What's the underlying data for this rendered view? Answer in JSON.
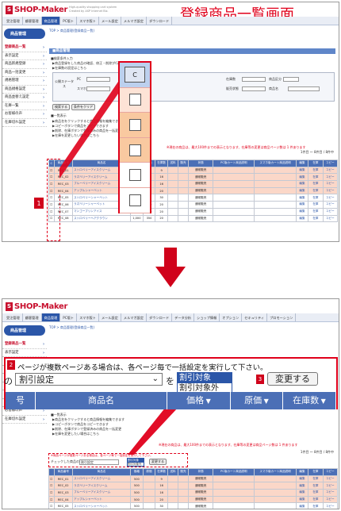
{
  "top": {
    "title_overlay": "登録商品一覧画面",
    "logo": "SHOP-Maker",
    "tagline": "High-quality shopping cart system\nCreated by ASP Internet Biz.",
    "nav": [
      "受注管理",
      "顧客管理",
      "商品管理",
      "PC版ト",
      "スマホ版ト",
      "メール設定",
      "メルマガ設定",
      "ダウンロード"
    ],
    "nav_active": 2,
    "sidebar_cat": "商品管理",
    "sidebar": [
      "登録商品一覧",
      "表示設定",
      "商品新規登録",
      "商品一括変更",
      "規格管理",
      "商品規格設定",
      "商品並替え設定",
      "在庫一覧",
      "お客様の声",
      "在庫切れ設定"
    ],
    "crumb": "TOP > 商品管理(登録商品一覧)",
    "section": "■商品管理",
    "search_heading": "■検索条件入力",
    "search_notes": [
      "▶商品登録をした商品の確認、修正・削除が行えます",
      "▶在庫数の設定はこちら"
    ],
    "labels": {
      "status": "公開ステータス",
      "pc": "PC",
      "smart": "スマホ",
      "stock": "在庫数",
      "category": "商品区分",
      "cart": "カート",
      "kind": "販売状態",
      "brand": "商品名"
    },
    "buttons": {
      "search": "検索する",
      "reset": "条件をクリア"
    },
    "list_heading": "■一覧表示",
    "list_notes": [
      "▶商品名をクリックすると商品情報を編集できます",
      "▶コピーボタンで商品をコピーできます",
      "▶削除、在庫ボタンで登録済みの商品を一括変更",
      "▶在庫を変更したい場合はこちら"
    ],
    "warn": "※現在の商品は、最大100件までの表示となります、在庫等の変更は商品ページ数は 1 件あります",
    "count_text": "1件目 ～ 8件目 / 8件中",
    "checkbox_popup": [
      "C",
      "",
      "",
      "",
      "",
      ""
    ],
    "callout": "1",
    "table": {
      "headers": [
        "C",
        "商品番号",
        "商品名",
        "価格",
        "原価",
        "在庫数",
        "送料",
        "販売",
        "状態",
        "PC版カート商品説明",
        "スマホ版カート商品説明",
        "編集",
        "在庫",
        "コピー"
      ],
      "rows": [
        {
          "no": "REC_01",
          "name": "ストロベリーアイスクリーム",
          "price": "500",
          "cost": "",
          "stock": "9",
          "ship": "",
          "sale": "",
          "state": "通常販売",
          "edit": "編集",
          "stk": "在庫",
          "copy": "コピー",
          "pink": true
        },
        {
          "no": "REC_02",
          "name": "ラズベリーアイスクリーム",
          "price": "500",
          "cost": "",
          "stock": "16",
          "ship": "",
          "sale": "",
          "state": "通常販売",
          "edit": "編集",
          "stk": "在庫",
          "copy": "コピー",
          "pink": true
        },
        {
          "no": "REC_03",
          "name": "ブルーベリーアイスクリーム",
          "price": "500",
          "cost": "",
          "stock": "16",
          "ship": "",
          "sale": "",
          "state": "通常販売",
          "edit": "編集",
          "stk": "在庫",
          "copy": "コピー",
          "pink": true
        },
        {
          "no": "REC_04",
          "name": "アップルシャーベット",
          "price": "500",
          "cost": "",
          "stock": "20",
          "ship": "",
          "sale": "",
          "state": "通常販売",
          "edit": "編集",
          "stk": "在庫",
          "copy": "コピー",
          "pink": true
        },
        {
          "no": "REC_05",
          "name": "ストロベリーシャーベット",
          "price": "500",
          "cost": "",
          "stock": "30",
          "ship": "",
          "sale": "",
          "state": "通常販売",
          "edit": "編集",
          "stk": "在庫",
          "copy": "コピー",
          "pink": false
        },
        {
          "no": "REC_06",
          "name": "ラズベリーシャーベット",
          "price": "500",
          "cost": "180",
          "stock": "20",
          "ship": "",
          "sale": "",
          "state": "通常販売",
          "edit": "編集",
          "stk": "在庫",
          "copy": "コピー",
          "pink": false
        },
        {
          "no": "REC_07",
          "name": "マンゴープリンアイス",
          "price": "500",
          "cost": "180",
          "stock": "20",
          "ship": "",
          "sale": "",
          "state": "通常販売",
          "edit": "編集",
          "stk": "在庫",
          "copy": "コピー",
          "pink": false
        },
        {
          "no": "REC_08",
          "name": "ストロベリーヘアクラウン",
          "price": "1,000",
          "cost": "350",
          "stock": "20",
          "ship": "",
          "sale": "",
          "state": "通常販売",
          "edit": "編集",
          "stk": "在庫",
          "copy": "コピー",
          "pink": false
        }
      ]
    }
  },
  "bottom": {
    "logo": "SHOP-Maker",
    "nav": [
      "受注管理",
      "顧客管理",
      "商品管理",
      "PC版ト",
      "スマホ版ト",
      "メール設定",
      "メルマガ設定",
      "ダウンロード",
      "データ分析",
      "ショップ情報",
      "オプション",
      "セキュリティ",
      "プロモーション"
    ],
    "nav_active": 2,
    "sidebar_cat": "商品管理",
    "sidebar": [
      "登録商品一覧",
      "表示設定",
      "商品新規登録",
      "商品一括変更",
      "規格管理",
      "商品規格設定",
      "商品並替え設定",
      "在庫一覧",
      "お客様の声",
      "在庫切れ設定"
    ],
    "crumb": "TOP > 商品管理(登録商品一覧)",
    "callout2": "2",
    "callout3": "3",
    "zoom_note": "ページが複数ページある場合は、各ページ毎で一括設定を実行して下さい。",
    "zoom_prefix": "の",
    "zoom_select": "割引設定",
    "zoom_wo": "を",
    "zoom_options": [
      "割引対象",
      "割引対象外"
    ],
    "zoom_button": "変更する",
    "zoom_headers": [
      "号",
      "商品名",
      "価格",
      "原価",
      "在庫数"
    ],
    "list_heading": "■一覧表示",
    "list_notes": [
      "▶商品名をクリックすると商品情報を編集できます",
      "▶コピーボタンで商品をコピーできます",
      "▶削除、在庫ボタンで登録済みの商品を一括変更",
      "▶在庫を変更したい場合はこちら"
    ],
    "warn": "※現在の商品は、最大100件までの表示となります、在庫等の変更は商品ページ数は 1 件あります",
    "count_text": "1件目 ～ 8件目 / 8件中",
    "mini_prefix": "チェックした商品の",
    "mini_select": "割引設定",
    "mini_options": [
      "割引対象",
      "割引対象外"
    ],
    "mini_button": "変更する",
    "table": {
      "headers": [
        "",
        "商品番号",
        "商品名",
        "価格",
        "原価",
        "在庫数",
        "送料",
        "販売",
        "状態",
        "PC版カート商品説明",
        "スマホ版カート商品説明",
        "編集",
        "在庫",
        "コピー"
      ],
      "rows": [
        {
          "no": "REC_01",
          "name": "ストロベリーアイスクリーム",
          "price": "500",
          "cost": "",
          "stock": "9",
          "state": "通常販売",
          "pink": true
        },
        {
          "no": "REC_02",
          "name": "ラズベリーアイスクリーム",
          "price": "500",
          "cost": "",
          "stock": "16",
          "state": "通常販売",
          "pink": true
        },
        {
          "no": "REC_03",
          "name": "ブルーベリーアイスクリーム",
          "price": "500",
          "cost": "",
          "stock": "16",
          "state": "通常販売",
          "pink": true
        },
        {
          "no": "REC_04",
          "name": "アップルシャーベット",
          "price": "500",
          "cost": "",
          "stock": "20",
          "state": "通常販売",
          "pink": true
        },
        {
          "no": "REC_05",
          "name": "ストロベリーシャーベット",
          "price": "500",
          "cost": "",
          "stock": "30",
          "state": "通常販売",
          "pink": false
        },
        {
          "no": "REC_06",
          "name": "ラズベリーシャーベット",
          "price": "500",
          "cost": "180",
          "stock": "20",
          "state": "通常販売",
          "pink": false
        }
      ]
    }
  },
  "colors": {
    "accent": "#d0021b",
    "brand": "#2b56a8",
    "header": "#4b6fb6",
    "pink": "#fbd7c8",
    "orange": "#f7c79a"
  }
}
